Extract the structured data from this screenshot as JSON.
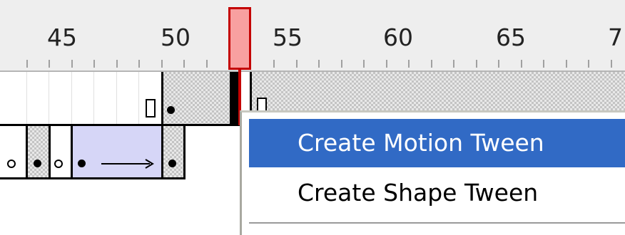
{
  "timeline": {
    "ruler_labels": [
      "45",
      "50",
      "55",
      "60",
      "65",
      "7"
    ],
    "current_frame_color": "#f8a0a0",
    "playhead_border_color": "#c40000"
  },
  "context_menu": {
    "items": [
      {
        "label": "Create Motion Tween",
        "highlighted": true
      },
      {
        "label": "Create Shape Tween",
        "highlighted": false
      }
    ],
    "highlight_color": "#316ac5"
  },
  "icons": {
    "keyframe": "filled-circle",
    "blank_keyframe": "hollow-circle",
    "frame_end": "hollow-rectangle",
    "tween": "arrow-right"
  }
}
